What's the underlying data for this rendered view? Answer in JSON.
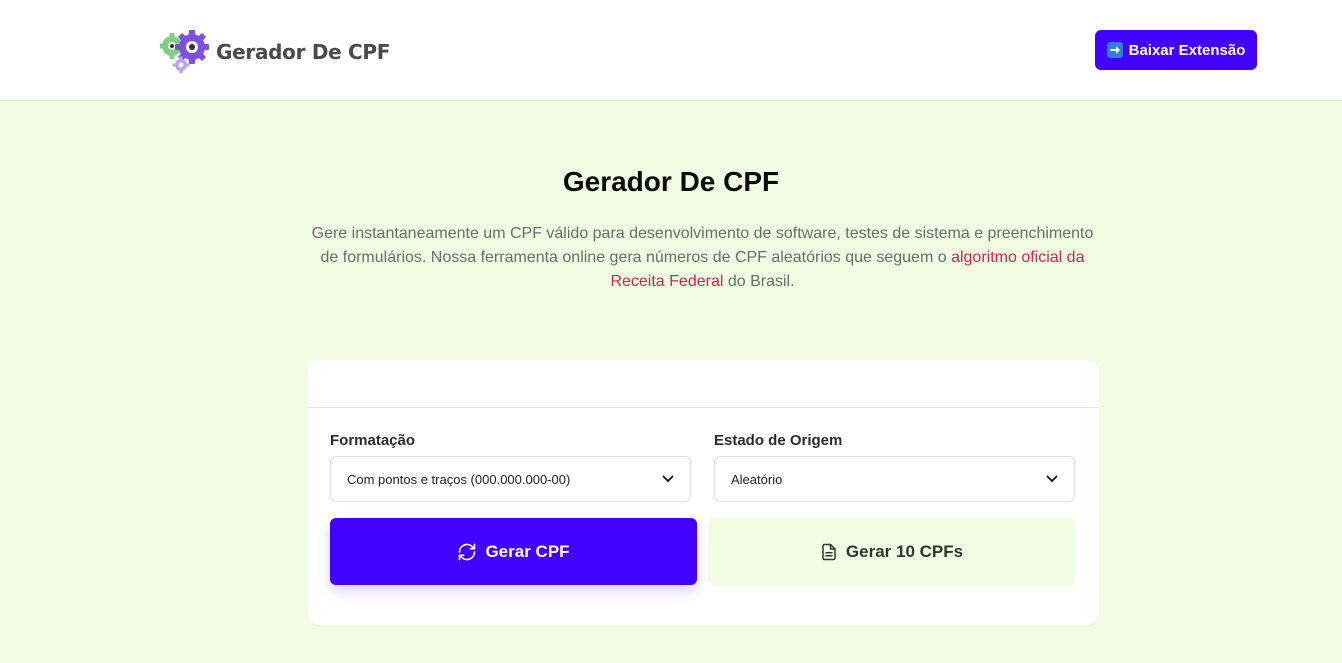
{
  "header": {
    "logo_text": "Gerador De CPF",
    "download_button": "Baixar Extensão"
  },
  "hero": {
    "title": "Gerador De CPF",
    "description_before": "Gere instantaneamente um CPF válido para desenvolvimento de software, testes de sistema e preenchimento de formulários. Nossa ferramenta online gera números de CPF aleatórios que seguem o ",
    "description_link": "algoritmo oficial da Receita Federal",
    "description_after": " do Brasil."
  },
  "form": {
    "format_label": "Formatação",
    "format_value": "Com pontos e traços (000.000.000-00)",
    "state_label": "Estado de Origem",
    "state_value": "Aleatório",
    "generate_button": "Gerar CPF",
    "generate_10_button": "Gerar 10 CPFs"
  },
  "icons": {
    "logo": "gears-icon",
    "download": "right-arrow-icon",
    "generate": "refresh-icon",
    "generate_10": "document-icon",
    "select": "chevron-down-icon"
  },
  "colors": {
    "accent": "#4100ff",
    "background": "#f1fde3",
    "link": "#c52a52"
  }
}
